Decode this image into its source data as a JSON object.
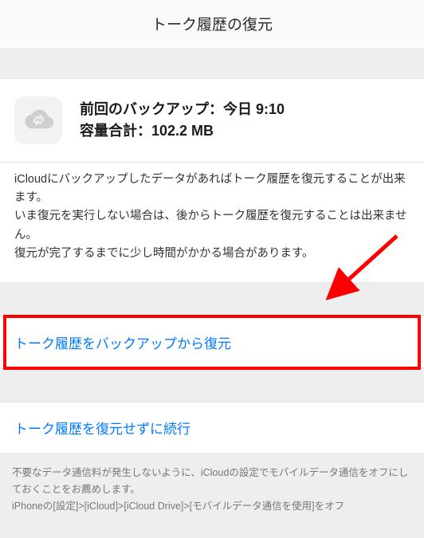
{
  "header": {
    "title": "トーク履歴の復元"
  },
  "backup": {
    "line1": "前回のバックアップ：今日 9:10",
    "line2": "容量合計：102.2 MB"
  },
  "description": {
    "p1": "iCloudにバックアップしたデータがあればトーク履歴を復元することが出来ます。",
    "p2": "いま復元を実行しない場合は、後からトーク履歴を復元することは出来ません。",
    "p3": "復元が完了するまでに少し時間がかかる場合があります。"
  },
  "buttons": {
    "restore": "トーク履歴をバックアップから復元",
    "skip": "トーク履歴を復元せずに続行"
  },
  "footer": {
    "p1": "不要なデータ通信料が発生しないように、iCloudの設定でモバイルデータ通信をオフにしておくことをお薦めします。",
    "p2": "iPhoneの[設定]>[iCloud]>[iCloud Drive]>[モバイルデータ通信を使用]をオフ"
  }
}
